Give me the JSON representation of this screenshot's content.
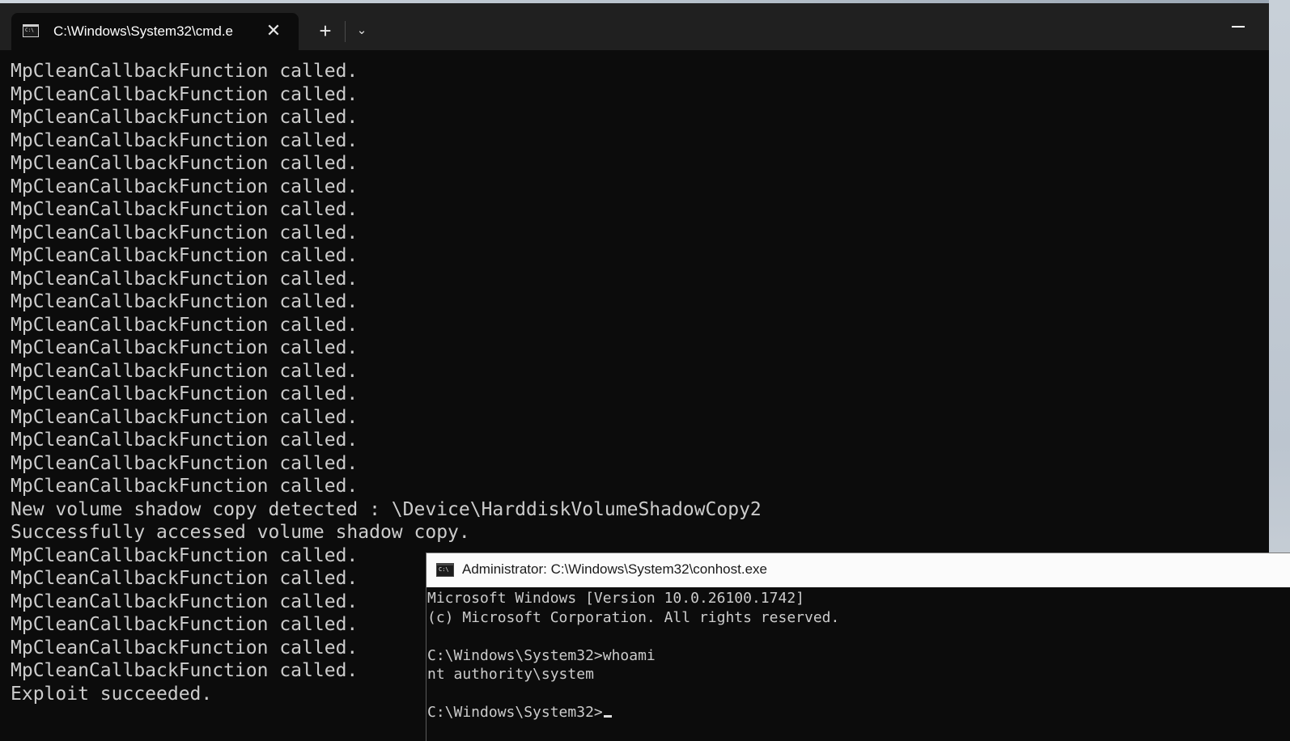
{
  "terminal": {
    "tab_title": "C:\\Windows\\System32\\cmd.e",
    "icons": {
      "tab": "command-prompt-icon",
      "close": "close-icon",
      "new_tab": "plus-icon",
      "dropdown": "chevron-down-icon",
      "minimize": "minimize-icon"
    },
    "lines": [
      "MpCleanCallbackFunction called.",
      "MpCleanCallbackFunction called.",
      "MpCleanCallbackFunction called.",
      "MpCleanCallbackFunction called.",
      "MpCleanCallbackFunction called.",
      "MpCleanCallbackFunction called.",
      "MpCleanCallbackFunction called.",
      "MpCleanCallbackFunction called.",
      "MpCleanCallbackFunction called.",
      "MpCleanCallbackFunction called.",
      "MpCleanCallbackFunction called.",
      "MpCleanCallbackFunction called.",
      "MpCleanCallbackFunction called.",
      "MpCleanCallbackFunction called.",
      "MpCleanCallbackFunction called.",
      "MpCleanCallbackFunction called.",
      "MpCleanCallbackFunction called.",
      "MpCleanCallbackFunction called.",
      "MpCleanCallbackFunction called.",
      "New volume shadow copy detected : \\Device\\HarddiskVolumeShadowCopy2",
      "Successfully accessed volume shadow copy.",
      "MpCleanCallbackFunction called.",
      "MpCleanCallbackFunction called.",
      "MpCleanCallbackFunction called.",
      "MpCleanCallbackFunction called.",
      "MpCleanCallbackFunction called.",
      "MpCleanCallbackFunction called.",
      "Exploit succeeded."
    ],
    "colors": {
      "background": "#0c0c0c",
      "text": "#cccccc",
      "tab_strip": "#202020"
    }
  },
  "conhost": {
    "title": "Administrator: C:\\Windows\\System32\\conhost.exe",
    "icon": "command-prompt-icon",
    "lines": [
      "Microsoft Windows [Version 10.0.26100.1742]",
      "(c) Microsoft Corporation. All rights reserved.",
      "",
      "C:\\Windows\\System32>whoami",
      "nt authority\\system",
      "",
      "C:\\Windows\\System32>"
    ],
    "colors": {
      "titlebar": "#fbfbfb",
      "background": "#0c0c0c",
      "text": "#cccccc"
    }
  }
}
